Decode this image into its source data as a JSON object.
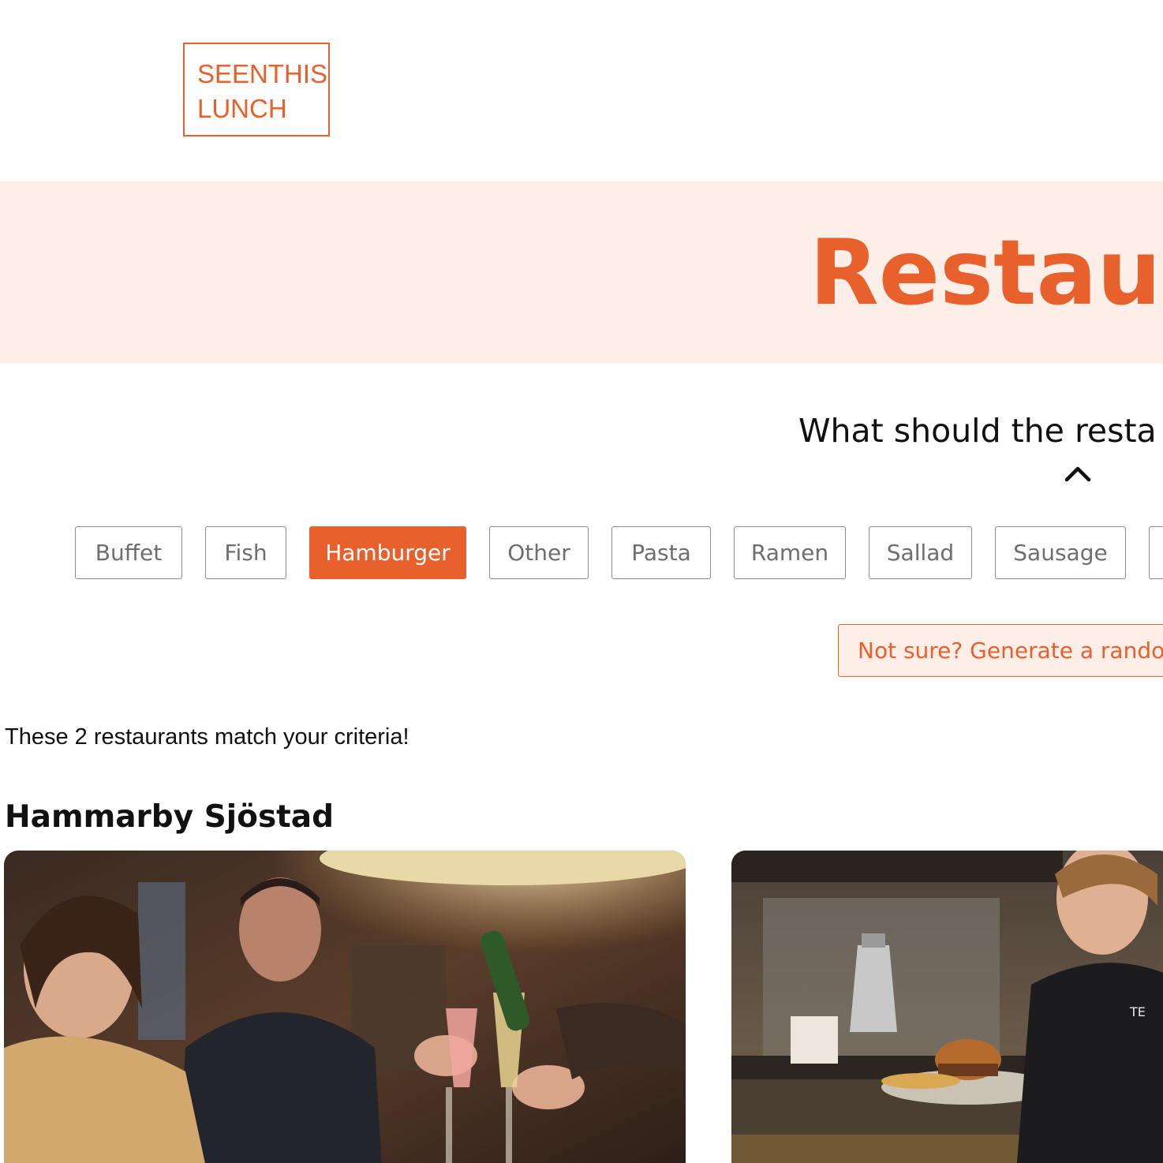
{
  "logo": {
    "line1": "SEENTHIS",
    "line2": "LUNCH"
  },
  "hero": {
    "title": "Restaura"
  },
  "filter_section": {
    "question": "What should the resta",
    "chevron_icon": "chevron-up-icon"
  },
  "filters": [
    {
      "label": "Buffet",
      "active": false
    },
    {
      "label": "Fish",
      "active": false
    },
    {
      "label": "Hamburger",
      "active": true
    },
    {
      "label": "Other",
      "active": false
    },
    {
      "label": "Pasta",
      "active": false
    },
    {
      "label": "Ramen",
      "active": false
    },
    {
      "label": "Sallad",
      "active": false
    },
    {
      "label": "Sausage",
      "active": false
    },
    {
      "label": "",
      "active": false
    }
  ],
  "random_button": {
    "label": "Not sure? Generate a randor"
  },
  "results": {
    "summary": "These 2 restaurants match your criteria!",
    "area": "Hammarby Sjöstad"
  },
  "colors": {
    "accent": "#e8602c",
    "accent_light": "#fdeee7",
    "chip_border": "#8a8a8a",
    "chip_text": "#6e6e6e",
    "text": "#111111"
  }
}
